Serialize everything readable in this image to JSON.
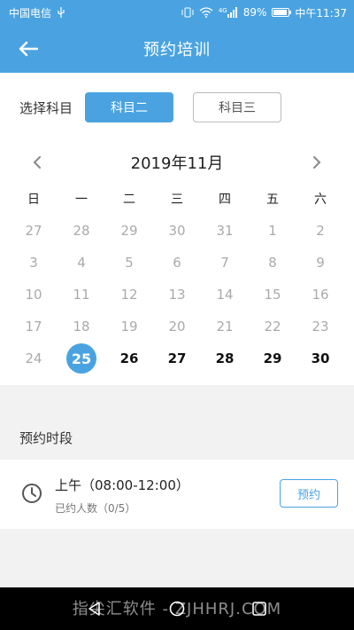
{
  "status_bar": {
    "carrier": "中国电信",
    "usb_icon": "usb-icon",
    "signal_label": "4G",
    "battery": "89%",
    "battery_level": 0.89,
    "time": "中午11:37"
  },
  "header": {
    "title": "预约培训",
    "back_icon": "back-arrow-icon"
  },
  "subject": {
    "label": "选择科目",
    "options": [
      {
        "label": "科目二",
        "selected": true
      },
      {
        "label": "科目三",
        "selected": false
      }
    ]
  },
  "calendar": {
    "month_title": "2019年11月",
    "weekdays": [
      "日",
      "一",
      "二",
      "三",
      "四",
      "五",
      "六"
    ],
    "days": [
      {
        "d": "27",
        "s": "muted"
      },
      {
        "d": "28",
        "s": "muted"
      },
      {
        "d": "29",
        "s": "muted"
      },
      {
        "d": "30",
        "s": "muted"
      },
      {
        "d": "31",
        "s": "muted"
      },
      {
        "d": "1",
        "s": "muted"
      },
      {
        "d": "2",
        "s": "muted"
      },
      {
        "d": "3",
        "s": "muted"
      },
      {
        "d": "4",
        "s": "muted"
      },
      {
        "d": "5",
        "s": "muted"
      },
      {
        "d": "6",
        "s": "muted"
      },
      {
        "d": "7",
        "s": "muted"
      },
      {
        "d": "8",
        "s": "muted"
      },
      {
        "d": "9",
        "s": "muted"
      },
      {
        "d": "10",
        "s": "muted"
      },
      {
        "d": "11",
        "s": "muted"
      },
      {
        "d": "12",
        "s": "muted"
      },
      {
        "d": "13",
        "s": "muted"
      },
      {
        "d": "14",
        "s": "muted"
      },
      {
        "d": "15",
        "s": "muted"
      },
      {
        "d": "16",
        "s": "muted"
      },
      {
        "d": "17",
        "s": "muted"
      },
      {
        "d": "18",
        "s": "muted"
      },
      {
        "d": "19",
        "s": "muted"
      },
      {
        "d": "20",
        "s": "muted"
      },
      {
        "d": "21",
        "s": "muted"
      },
      {
        "d": "22",
        "s": "muted"
      },
      {
        "d": "23",
        "s": "muted"
      },
      {
        "d": "24",
        "s": "muted"
      },
      {
        "d": "25",
        "s": "selected"
      },
      {
        "d": "26",
        "s": "active"
      },
      {
        "d": "27",
        "s": "active"
      },
      {
        "d": "28",
        "s": "active"
      },
      {
        "d": "29",
        "s": "active"
      },
      {
        "d": "30",
        "s": "active"
      }
    ]
  },
  "slots": {
    "section_title": "预约时段",
    "items": [
      {
        "time": "上午（08:00-12:00）",
        "count": "已约人数（0/5）",
        "button": "预约",
        "icon": "clock-icon"
      }
    ]
  },
  "watermark": "指尖汇软件 - ZJHHRJ.COM",
  "colors": {
    "accent": "#4aa3e0",
    "muted_text": "#aaaaaa"
  }
}
